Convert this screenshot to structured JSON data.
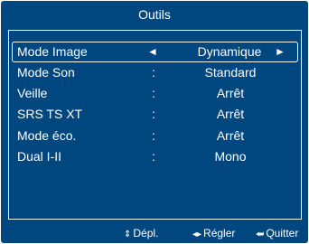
{
  "menu": {
    "title": "Outils",
    "items": [
      {
        "label": "Mode Image",
        "separator": "",
        "value": "Dynamique",
        "selected": true,
        "left_arrow": "◄",
        "right_arrow": "►"
      },
      {
        "label": "Mode Son",
        "separator": ":",
        "value": "Standard"
      },
      {
        "label": "Veille",
        "separator": ":",
        "value": "Arrêt"
      },
      {
        "label": "SRS TS XT",
        "separator": ":",
        "value": "Arrêt"
      },
      {
        "label": "Mode éco.",
        "separator": ":",
        "value": "Arrêt"
      },
      {
        "label": "Dual I-II",
        "separator": ":",
        "value": "Mono"
      }
    ]
  },
  "footer": {
    "move_icon": "up-down-arrow-icon",
    "move_glyph": "⇕",
    "move_label": "Dépl.",
    "adjust_icon": "left-right-arrow-icon",
    "adjust_glyph": "◂▸",
    "adjust_label": "Régler",
    "exit_icon": "exit-icon",
    "exit_glyph": "⮨",
    "exit_label": "Quitter"
  },
  "colors": {
    "background": "#00467f",
    "text": "#ffffff"
  }
}
